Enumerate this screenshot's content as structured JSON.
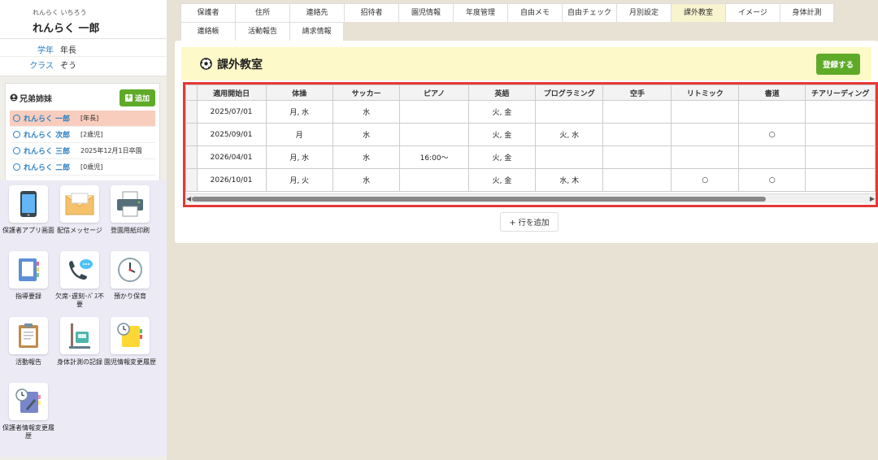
{
  "profile": {
    "furigana": "れんらく いちろう",
    "name": "れんらく 一郎"
  },
  "info": [
    {
      "label": "学年",
      "value": "年長"
    },
    {
      "label": "クラス",
      "value": "ぞう"
    }
  ],
  "siblings": {
    "title": "兄弟姉妹",
    "add_label": "追加",
    "items": [
      {
        "name": "れんらく 一郎",
        "tag": "[年長]"
      },
      {
        "name": "れんらく 次郎",
        "tag": "[2歳児]"
      },
      {
        "name": "れんらく 三郎",
        "tag": "2025年12月1日卒園"
      },
      {
        "name": "れんらく 二郎",
        "tag": "[0歳児]"
      }
    ]
  },
  "menu": [
    {
      "label": "保護者アプリ画面",
      "icon": "smartphone-icon"
    },
    {
      "label": "配信メッセージ",
      "icon": "envelope-icon"
    },
    {
      "label": "登園用紙印刷",
      "icon": "printer-icon"
    },
    {
      "label": "指導要録",
      "icon": "notebook-icon"
    },
    {
      "label": "欠席･遅刻･ﾊﾞｽ不要",
      "icon": "phone-chat-icon"
    },
    {
      "label": "預かり保育",
      "icon": "clock-icon"
    },
    {
      "label": "活動報告",
      "icon": "clipboard-icon"
    },
    {
      "label": "身体計測の記録",
      "icon": "scale-icon"
    },
    {
      "label": "園児情報変更履歴",
      "icon": "history-notes-icon"
    },
    {
      "label": "保護者情報変更履歴",
      "icon": "history-notebook-icon"
    }
  ],
  "tabs": {
    "row1": [
      "保護者",
      "住所",
      "連絡先",
      "招待者",
      "園児情報",
      "年度管理",
      "自由メモ",
      "自由チェック",
      "月別設定",
      "課外教室",
      "イメージ",
      "身体計測"
    ],
    "row2": [
      "連絡帳",
      "活動報告",
      "請求情報"
    ],
    "active": "課外教室"
  },
  "panel": {
    "title": "課外教室",
    "save_label": "登録する",
    "add_row_label": "+ 行を追加"
  },
  "table": {
    "columns": [
      "適用開始日",
      "体操",
      "サッカー",
      "ピアノ",
      "英語",
      "プログラミング",
      "空手",
      "リトミック",
      "書道",
      "チアリーディング"
    ],
    "rows": [
      [
        "2025/07/01",
        "月, 水",
        "水",
        "",
        "火, 金",
        "",
        "",
        "",
        "",
        ""
      ],
      [
        "2025/09/01",
        "月",
        "水",
        "",
        "火, 金",
        "火, 水",
        "",
        "",
        "○",
        ""
      ],
      [
        "2026/04/01",
        "月, 水",
        "水",
        "16:00～",
        "火, 金",
        "",
        "",
        "",
        "",
        ""
      ],
      [
        "2026/10/01",
        "月, 火",
        "水",
        "",
        "火, 金",
        "水, 木",
        "",
        "○",
        "○",
        ""
      ]
    ]
  },
  "colors": {
    "accent_green": "#5fab29",
    "link_blue": "#2a7fc4",
    "highlight_red": "#e53935",
    "active_tab": "#f7f4cf"
  }
}
